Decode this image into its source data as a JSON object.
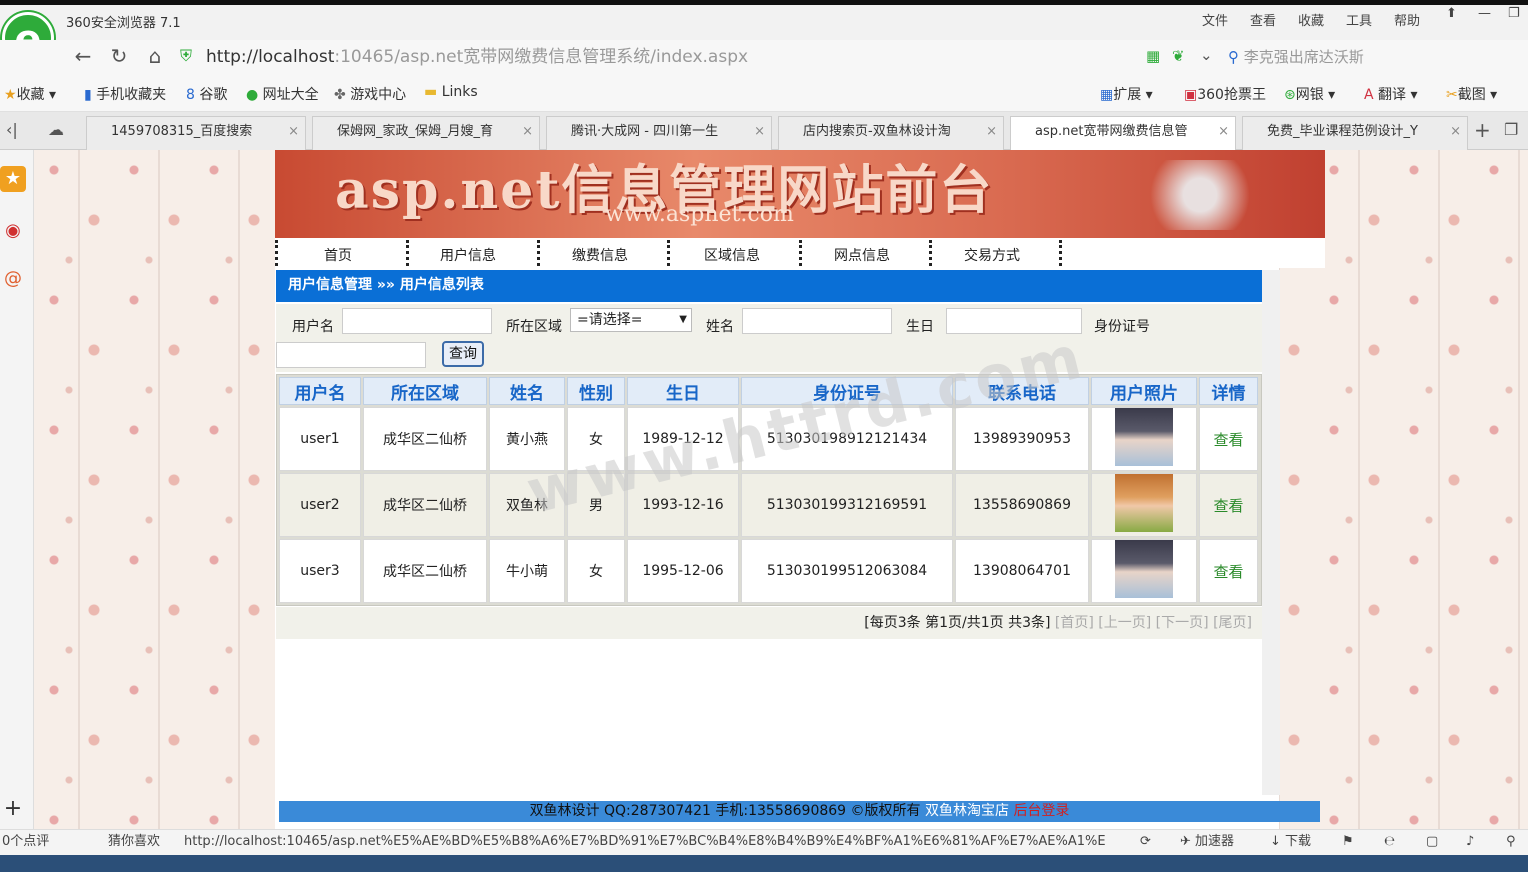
{
  "browser": {
    "app_title": "360安全浏览器 7.1",
    "menu": [
      "文件",
      "查看",
      "收藏",
      "工具",
      "帮助"
    ],
    "url_host": "http://localhost",
    "url_rest": ":10465/asp.net宽带网缴费信息管理系统/index.aspx",
    "search_text": "李克强出席达沃斯",
    "bookmarks": [
      "收藏",
      "手机收藏夹",
      "谷歌",
      "网址大全",
      "游戏中心",
      "Links"
    ],
    "tools": [
      "扩展",
      "360抢票王",
      "网银",
      "翻译",
      "截图"
    ],
    "tabs": [
      {
        "label": "1459708315_百度搜索",
        "active": false
      },
      {
        "label": "保姆网_家政_保姆_月嫂_育",
        "active": false
      },
      {
        "label": "腾讯·大成网 - 四川第一生",
        "active": false
      },
      {
        "label": "店内搜索页-双鱼林设计淘",
        "active": false
      },
      {
        "label": "asp.net宽带网缴费信息管",
        "active": true
      },
      {
        "label": "免费_毕业课程范例设计_Y",
        "active": false
      }
    ],
    "status": {
      "comments": "0个点评",
      "guess": "猜你喜欢",
      "status_url": "http://localhost:10465/asp.net%E5%AE%BD%E5%B8%A6%E7%BD%91%E7%BC%B4%E8%B4%B9%E4%BF%A1%E6%81%AF%E7%AE%A1%E",
      "accelerator": "加速器",
      "download": "下载"
    }
  },
  "site": {
    "banner_title": "asp.net信息管理网站前台",
    "banner_url": "www.aspnet.com",
    "nav": [
      "首页",
      "用户信息",
      "缴费信息",
      "区域信息",
      "网点信息",
      "交易方式"
    ],
    "breadcrumb": "用户信息管理 »» 用户信息列表",
    "filter": {
      "username_label": "用户名",
      "area_label": "所在区域",
      "area_value": "=请选择=",
      "name_label": "姓名",
      "birthday_label": "生日",
      "idcard_label": "身份证号",
      "query_button": "查询"
    },
    "table": {
      "headers": [
        "用户名",
        "所在区域",
        "姓名",
        "性别",
        "生日",
        "身份证号",
        "联系电话",
        "用户照片",
        "详情"
      ],
      "rows": [
        [
          "user1",
          "成华区二仙桥",
          "黄小燕",
          "女",
          "1989-12-12",
          "513030198912121434",
          "13989390953",
          "",
          "查看"
        ],
        [
          "user2",
          "成华区二仙桥",
          "双鱼林",
          "男",
          "1993-12-16",
          "513030199312169591",
          "13558690869",
          "",
          "查看"
        ],
        [
          "user3",
          "成华区二仙桥",
          "牛小萌",
          "女",
          "1995-12-06",
          "513030199512063084",
          "13908064701",
          "",
          "查看"
        ]
      ]
    },
    "pager": {
      "summary": "[每页3条 第1页/共1页 共3条]",
      "first": "[首页]",
      "prev": "[上一页]",
      "next": "[下一页]",
      "last": "[尾页]"
    },
    "footer": {
      "text": "双鱼林设计  QQ:287307421 手机:13558690869 ©版权所有",
      "shop_link": "双鱼林淘宝店",
      "admin_link": "后台登录"
    }
  },
  "watermark": "www.httrd.com"
}
